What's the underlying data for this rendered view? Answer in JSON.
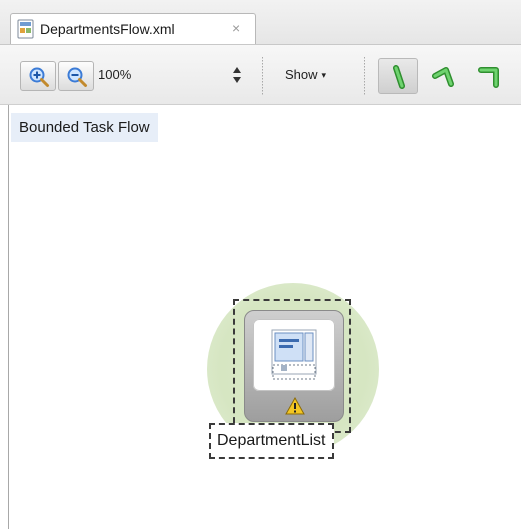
{
  "editor": {
    "tab": {
      "title": "DepartmentsFlow.xml",
      "close_glyph": "×",
      "icon": "xml-file-icon"
    }
  },
  "toolbar": {
    "zoom_in_icon": "zoom-in-icon",
    "zoom_out_icon": "zoom-out-icon",
    "zoom_value": "100%",
    "show_label": "Show",
    "show_caret": "▾",
    "route_buttons": [
      {
        "icon": "straight-line-icon",
        "active": true
      },
      {
        "icon": "curved-corner-icon",
        "active": false
      },
      {
        "icon": "right-angle-icon",
        "active": false
      }
    ]
  },
  "canvas": {
    "flow_type_label": "Bounded Task Flow",
    "activity": {
      "name": "DepartmentList",
      "icon": "view-activity-icon",
      "status_icon": "warning-icon",
      "selected": true,
      "is_default_activity": true
    }
  },
  "colors": {
    "accent_green": "#3aa63a",
    "default_activity_halo": "#d6e6c2",
    "label_highlight": "#e7eef8",
    "warning_yellow": "#f3c623"
  }
}
